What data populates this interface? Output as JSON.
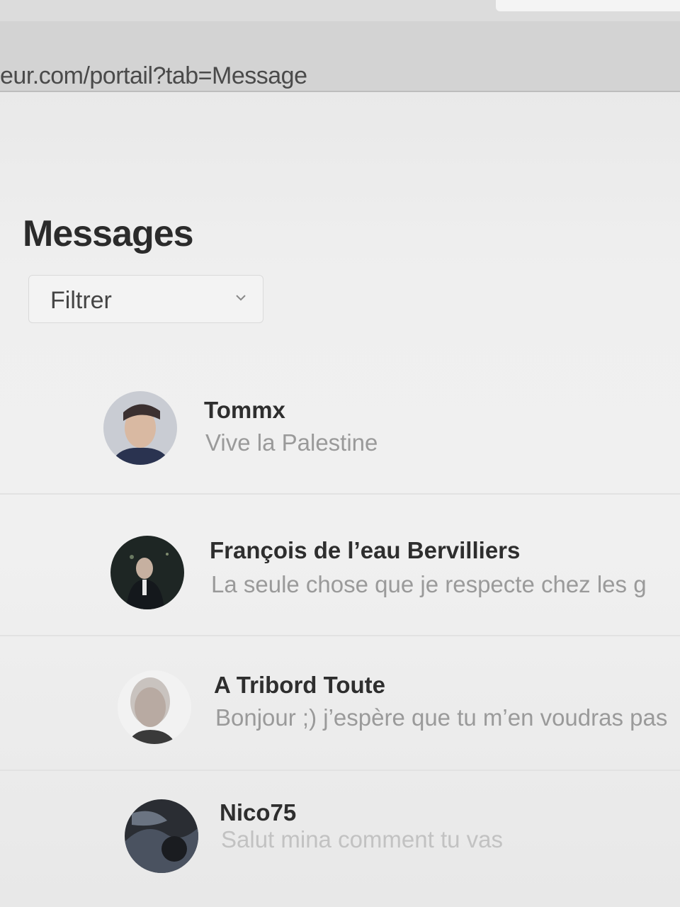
{
  "browser": {
    "url": "eur.com/portail?tab=Message"
  },
  "page": {
    "title": "Messages"
  },
  "filter": {
    "selected": "Filtrer"
  },
  "conversations": [
    {
      "name": "Tommx",
      "preview": "Vive la Palestine",
      "avatar_icon": "profile-photo"
    },
    {
      "name": "François de l’eau Bervilliers",
      "preview": "La seule chose que je respecte chez les g",
      "avatar_icon": "profile-photo"
    },
    {
      "name": "A Tribord Toute",
      "preview": "Bonjour ;) j’espère que tu m’en voudras pas",
      "avatar_icon": "profile-photo"
    },
    {
      "name": "Nico75",
      "preview": "Salut mina comment tu vas",
      "avatar_icon": "profile-photo"
    }
  ],
  "colors": {
    "title": "#2b2b2b",
    "name": "#2e2e2e",
    "preview": "#9a9a9a",
    "background": "#f0f0f0"
  }
}
